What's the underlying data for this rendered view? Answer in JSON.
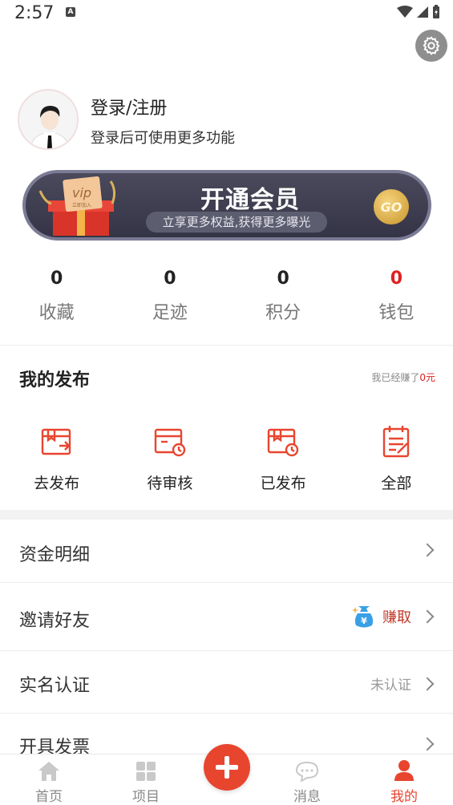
{
  "status_bar": {
    "time": "2:57"
  },
  "user": {
    "title": "登录/注册",
    "subtitle": "登录后可使用更多功能"
  },
  "vip": {
    "title": "开通会员",
    "subtitle": "立享更多权益,获得更多曝光",
    "go": "GO",
    "box_text": "vip",
    "box_sub": "立即加入"
  },
  "stats": [
    {
      "value": "0",
      "label": "收藏"
    },
    {
      "value": "0",
      "label": "足迹"
    },
    {
      "value": "0",
      "label": "积分"
    },
    {
      "value": "0",
      "label": "钱包"
    }
  ],
  "publish": {
    "title": "我的发布",
    "earn_prefix": "我已经赚了",
    "earn_amount": "0元",
    "items": [
      {
        "label": "去发布",
        "icon": "publish-icon"
      },
      {
        "label": "待审核",
        "icon": "pending-review-icon"
      },
      {
        "label": "已发布",
        "icon": "published-icon"
      },
      {
        "label": "全部",
        "icon": "all-list-icon"
      }
    ]
  },
  "menu": [
    {
      "label": "资金明细"
    },
    {
      "label": "邀请好友",
      "right_text": "赚取"
    },
    {
      "label": "实名认证",
      "right_text": "未认证"
    },
    {
      "label": "开具发票"
    }
  ],
  "tabs": [
    {
      "label": "首页",
      "icon": "home-icon"
    },
    {
      "label": "项目",
      "icon": "grid-icon"
    },
    {
      "label": "消息",
      "icon": "chat-icon"
    },
    {
      "label": "我的",
      "icon": "user-icon"
    }
  ],
  "colors": {
    "accent": "#e8452f",
    "vip_bg": "#3b3b4e",
    "red_value": "#e02020"
  }
}
